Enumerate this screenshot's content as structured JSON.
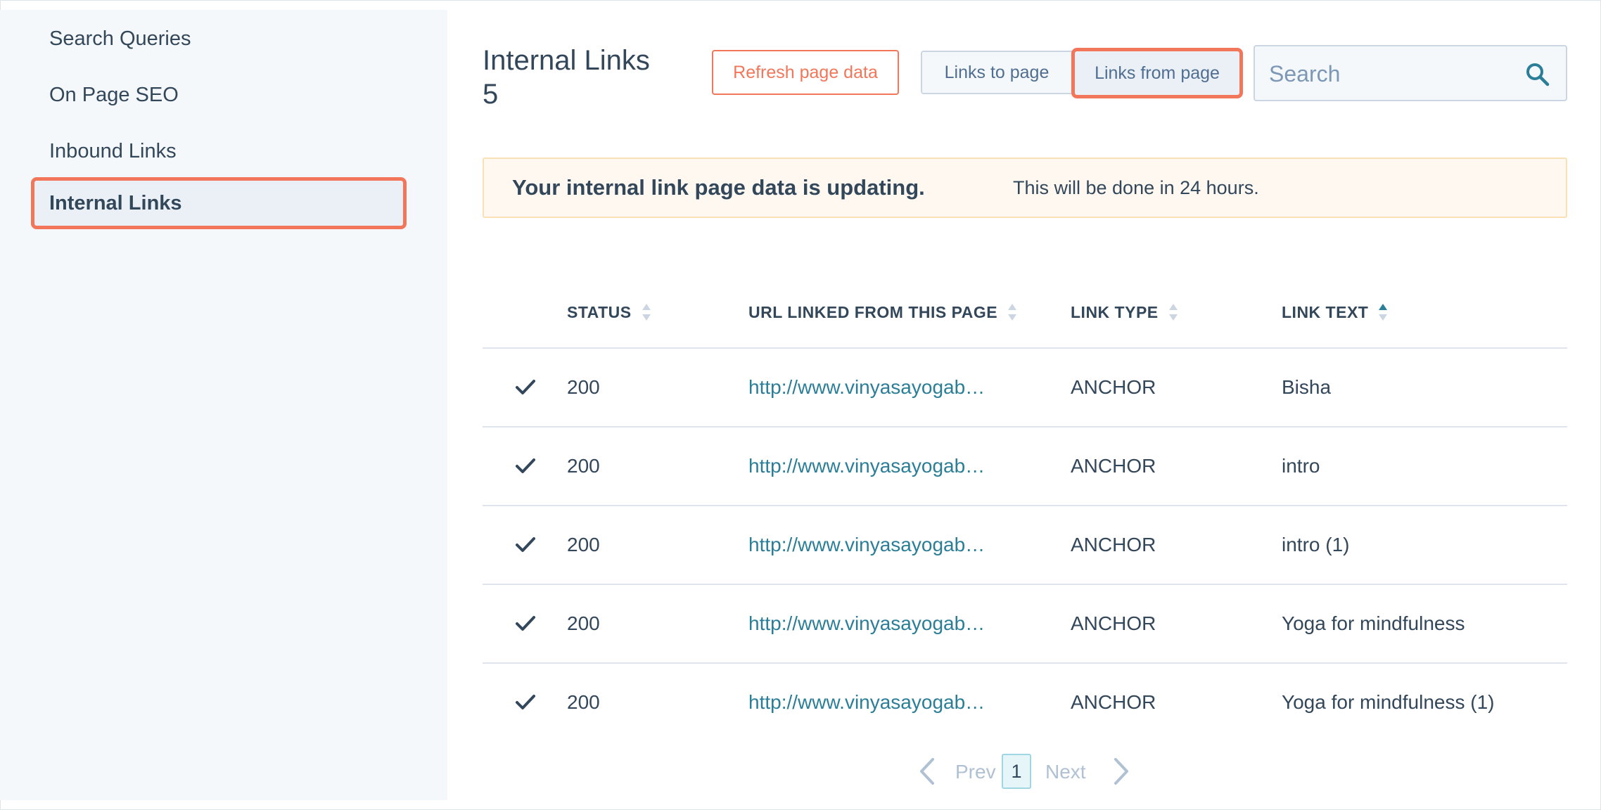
{
  "sidebar": {
    "items": [
      {
        "label": "Search Queries"
      },
      {
        "label": "On Page SEO"
      },
      {
        "label": "Inbound Links"
      },
      {
        "label": "Internal Links"
      }
    ]
  },
  "header": {
    "title": "Internal Links",
    "count": "5",
    "refresh_label": "Refresh page data",
    "links_to_label": "Links to page",
    "links_from_label": "Links from page",
    "search_placeholder": "Search"
  },
  "alert": {
    "strong": "Your internal link page data is updating.",
    "message": "This will be done in 24 hours."
  },
  "table": {
    "columns": [
      {
        "label": "STATUS"
      },
      {
        "label": "URL LINKED FROM THIS PAGE"
      },
      {
        "label": "LINK TYPE"
      },
      {
        "label": "LINK TEXT"
      }
    ],
    "rows": [
      {
        "status": "200",
        "url": "http://www.vinyasayogab…",
        "type": "ANCHOR",
        "text": "Bisha"
      },
      {
        "status": "200",
        "url": "http://www.vinyasayogab…",
        "type": "ANCHOR",
        "text": "intro"
      },
      {
        "status": "200",
        "url": "http://www.vinyasayogab…",
        "type": "ANCHOR",
        "text": "intro (1)"
      },
      {
        "status": "200",
        "url": "http://www.vinyasayogab…",
        "type": "ANCHOR",
        "text": "Yoga for mindfulness"
      },
      {
        "status": "200",
        "url": "http://www.vinyasayogab…",
        "type": "ANCHOR",
        "text": "Yoga for mindfulness (1)"
      }
    ]
  },
  "pager": {
    "prev_label": "Prev",
    "current_page": "1",
    "next_label": "Next"
  },
  "colors": {
    "accent": "#f2775a",
    "link": "#2b7e97",
    "text": "#33475b"
  }
}
